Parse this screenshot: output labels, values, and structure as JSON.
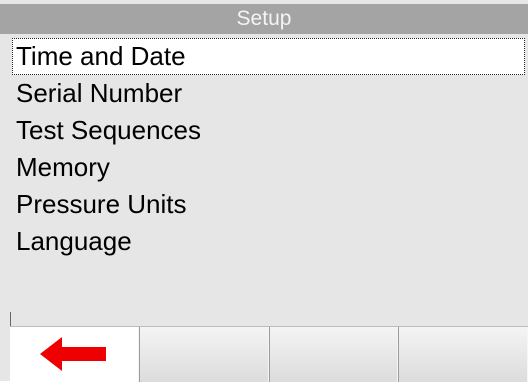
{
  "screen": {
    "title": "Setup"
  },
  "menu": {
    "items": [
      {
        "label": "Time and Date",
        "selected": true
      },
      {
        "label": "Serial Number",
        "selected": false
      },
      {
        "label": "Test Sequences",
        "selected": false
      },
      {
        "label": "Memory",
        "selected": false
      },
      {
        "label": "Pressure Units",
        "selected": false
      },
      {
        "label": "Language",
        "selected": false
      }
    ]
  },
  "softkeys": {
    "keys": [
      {
        "label": "",
        "icon": "back-arrow-icon"
      },
      {
        "label": "",
        "icon": ""
      },
      {
        "label": "",
        "icon": ""
      },
      {
        "label": "",
        "icon": ""
      }
    ]
  },
  "colors": {
    "background": "#e6e6e6",
    "title_bar": "#a4a4a4",
    "title_text": "#f4f4f4",
    "back_arrow": "#ee0000"
  }
}
